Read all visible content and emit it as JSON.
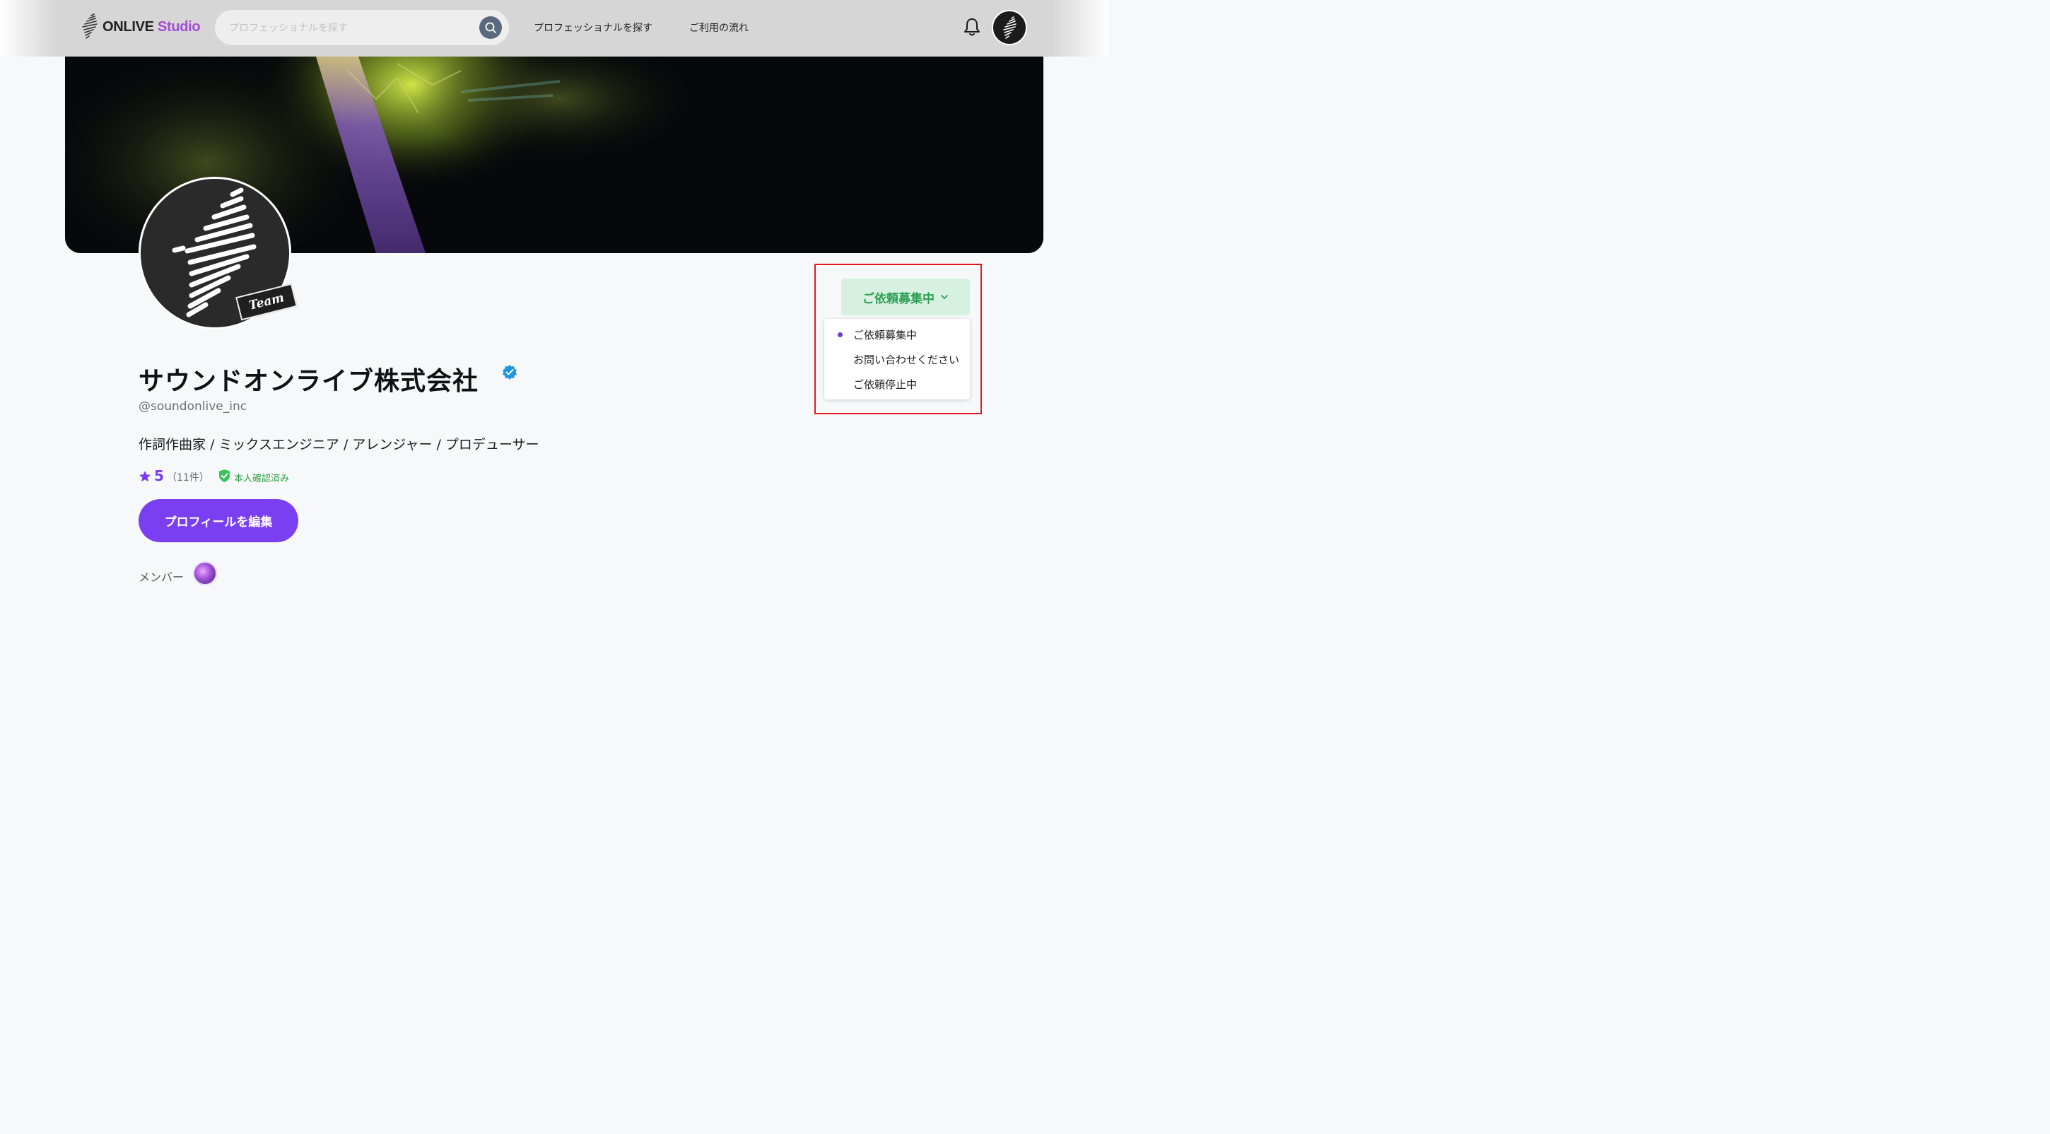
{
  "header": {
    "logo_text_1": "ONLIVE",
    "logo_text_2": "Studio",
    "search_placeholder": "プロフェッショナルを探す",
    "nav": [
      "プロフェッショナルを探す",
      "ご利用の流れ"
    ],
    "icons": [
      "search-icon",
      "bell-icon",
      "avatar"
    ]
  },
  "profile": {
    "team_tag": "Team",
    "name": "サウンドオンライブ株式会社",
    "handle": "@soundonlive_inc",
    "roles": "作詞作曲家 / ミックスエンジニア / アレンジャー / プロデューサー",
    "rating": "5",
    "rating_count": "（11件）",
    "verified_label": "本人確認済み",
    "edit_button": "プロフィールを編集",
    "members_label": "メンバー"
  },
  "status": {
    "current": "ご依頼募集中",
    "options": [
      "ご依頼募集中",
      "お問い合わせください",
      "ご依頼停止中"
    ],
    "accent_color": "#2f9e55"
  },
  "colors": {
    "brand_purple": "#7b3ff2",
    "highlight_red": "#e21b1b"
  }
}
